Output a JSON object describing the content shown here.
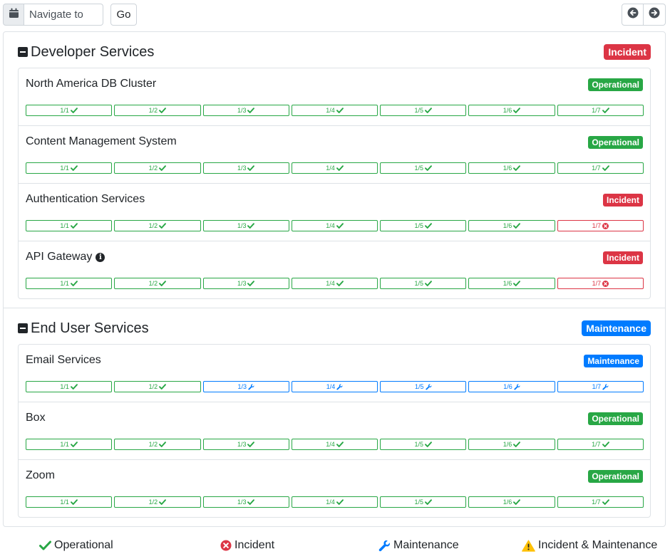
{
  "topbar": {
    "navigate_placeholder": "Navigate to",
    "go_label": "Go",
    "calendar_icon": "calendar-icon",
    "prev_icon": "arrow-left-circle-icon",
    "next_icon": "arrow-right-circle-icon"
  },
  "status_colors": {
    "operational": "#28a745",
    "incident": "#dc3545",
    "maintenance": "#007bff",
    "warning": "#ffc107"
  },
  "groups": [
    {
      "title": "Developer Services",
      "status": "Incident",
      "services": [
        {
          "name": "North America DB Cluster",
          "status": "Operational",
          "days": [
            {
              "label": "1/1",
              "state": "operational"
            },
            {
              "label": "1/2",
              "state": "operational"
            },
            {
              "label": "1/3",
              "state": "operational"
            },
            {
              "label": "1/4",
              "state": "operational"
            },
            {
              "label": "1/5",
              "state": "operational"
            },
            {
              "label": "1/6",
              "state": "operational"
            },
            {
              "label": "1/7",
              "state": "operational"
            }
          ]
        },
        {
          "name": "Content Management System",
          "status": "Operational",
          "days": [
            {
              "label": "1/1",
              "state": "operational"
            },
            {
              "label": "1/2",
              "state": "operational"
            },
            {
              "label": "1/3",
              "state": "operational"
            },
            {
              "label": "1/4",
              "state": "operational"
            },
            {
              "label": "1/5",
              "state": "operational"
            },
            {
              "label": "1/6",
              "state": "operational"
            },
            {
              "label": "1/7",
              "state": "operational"
            }
          ]
        },
        {
          "name": "Authentication Services",
          "status": "Incident",
          "days": [
            {
              "label": "1/1",
              "state": "operational"
            },
            {
              "label": "1/2",
              "state": "operational"
            },
            {
              "label": "1/3",
              "state": "operational"
            },
            {
              "label": "1/4",
              "state": "operational"
            },
            {
              "label": "1/5",
              "state": "operational"
            },
            {
              "label": "1/6",
              "state": "operational"
            },
            {
              "label": "1/7",
              "state": "incident"
            }
          ]
        },
        {
          "name": "API Gateway",
          "info": true,
          "status": "Incident",
          "days": [
            {
              "label": "1/1",
              "state": "operational"
            },
            {
              "label": "1/2",
              "state": "operational"
            },
            {
              "label": "1/3",
              "state": "operational"
            },
            {
              "label": "1/4",
              "state": "operational"
            },
            {
              "label": "1/5",
              "state": "operational"
            },
            {
              "label": "1/6",
              "state": "operational"
            },
            {
              "label": "1/7",
              "state": "incident"
            }
          ]
        }
      ]
    },
    {
      "title": "End User Services",
      "status": "Maintenance",
      "services": [
        {
          "name": "Email Services",
          "status": "Maintenance",
          "days": [
            {
              "label": "1/1",
              "state": "operational"
            },
            {
              "label": "1/2",
              "state": "operational"
            },
            {
              "label": "1/3",
              "state": "maintenance"
            },
            {
              "label": "1/4",
              "state": "maintenance"
            },
            {
              "label": "1/5",
              "state": "maintenance"
            },
            {
              "label": "1/6",
              "state": "maintenance"
            },
            {
              "label": "1/7",
              "state": "maintenance"
            }
          ]
        },
        {
          "name": "Box",
          "status": "Operational",
          "days": [
            {
              "label": "1/1",
              "state": "operational"
            },
            {
              "label": "1/2",
              "state": "operational"
            },
            {
              "label": "1/3",
              "state": "operational"
            },
            {
              "label": "1/4",
              "state": "operational"
            },
            {
              "label": "1/5",
              "state": "operational"
            },
            {
              "label": "1/6",
              "state": "operational"
            },
            {
              "label": "1/7",
              "state": "operational"
            }
          ]
        },
        {
          "name": "Zoom",
          "status": "Operational",
          "days": [
            {
              "label": "1/1",
              "state": "operational"
            },
            {
              "label": "1/2",
              "state": "operational"
            },
            {
              "label": "1/3",
              "state": "operational"
            },
            {
              "label": "1/4",
              "state": "operational"
            },
            {
              "label": "1/5",
              "state": "operational"
            },
            {
              "label": "1/6",
              "state": "operational"
            },
            {
              "label": "1/7",
              "state": "operational"
            }
          ]
        }
      ]
    }
  ],
  "legend": {
    "operational": "Operational",
    "incident": "Incident",
    "maintenance": "Maintenance",
    "incident_maintenance": "Incident & Maintenance"
  }
}
